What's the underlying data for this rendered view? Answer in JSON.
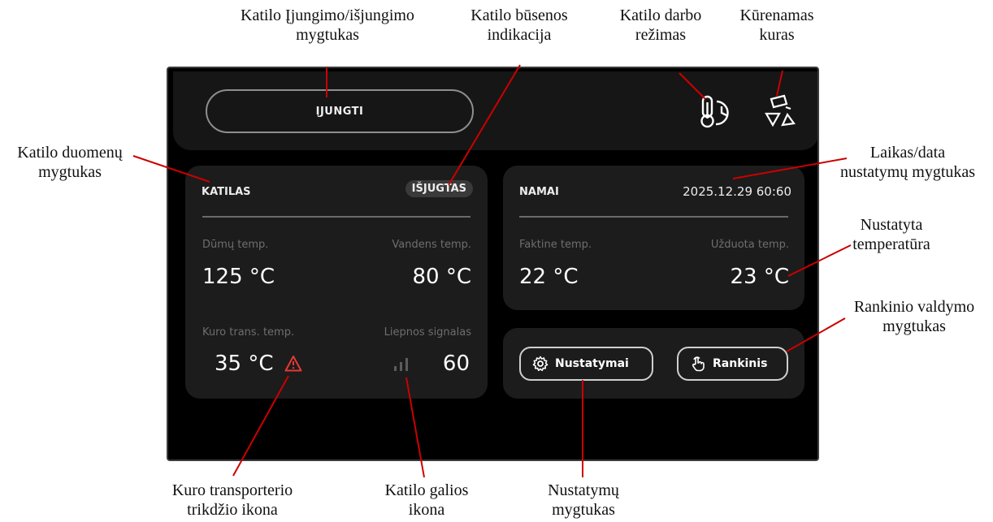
{
  "header": {
    "power_button_label": "ĮJUNGTI",
    "mode_icon": "thermometer-clock-icon",
    "fuel_icon": "fuel-shapes-icon"
  },
  "boiler": {
    "title": "KATILAS",
    "status": "IŠJUGTAS",
    "smoke_temp_label": "Dūmų temp.",
    "smoke_temp_value": "125 °C",
    "water_temp_label": "Vandens temp.",
    "water_temp_value": "80 °C",
    "fuel_trans_temp_label": "Kuro trans. temp.",
    "fuel_trans_temp_value": "35 °C",
    "flame_signal_label": "Liepnos signalas",
    "flame_signal_value": "60",
    "warning_icon": "warning-triangle-icon",
    "signal_icon": "signal-bars-icon"
  },
  "home": {
    "title": "NAMAI",
    "datetime": "2025.12.29  60:60",
    "actual_temp_label": "Faktine temp.",
    "actual_temp_value": "22 °C",
    "set_temp_label": "Užduota temp.",
    "set_temp_value": "23 °C"
  },
  "actions": {
    "settings_label": "Nustatymai",
    "manual_label": "Rankinis"
  },
  "annotations": {
    "power_button": [
      "Katilo Įjungimo/išjungimo",
      "mygtukas"
    ],
    "status_indication": [
      "Katilo būsenos",
      "indikacija"
    ],
    "work_mode": [
      "Katilo darbo",
      "režimas"
    ],
    "fuel": [
      "Kūrenamas",
      "kuras"
    ],
    "boiler_data_button": [
      "Katilo duomenų",
      "mygtukas"
    ],
    "datetime_button": [
      "Laikas/data",
      "nustatymų mygtukas"
    ],
    "set_temperature": [
      "Nustatyta",
      "temperatūra"
    ],
    "manual_button": [
      "Rankinio valdymo",
      "mygtukas"
    ],
    "conveyor_fault_icon": [
      "Kuro transporterio",
      "trikdžio ikona"
    ],
    "power_icon": [
      "Katilo galios",
      "ikona"
    ],
    "settings_button": [
      "Nustatymų",
      "mygtukas"
    ]
  },
  "colors": {
    "screen_bg": "#000000",
    "panel_bg": "#1c1c1c",
    "annotation_line": "#cc0000",
    "warning": "#e53935"
  }
}
